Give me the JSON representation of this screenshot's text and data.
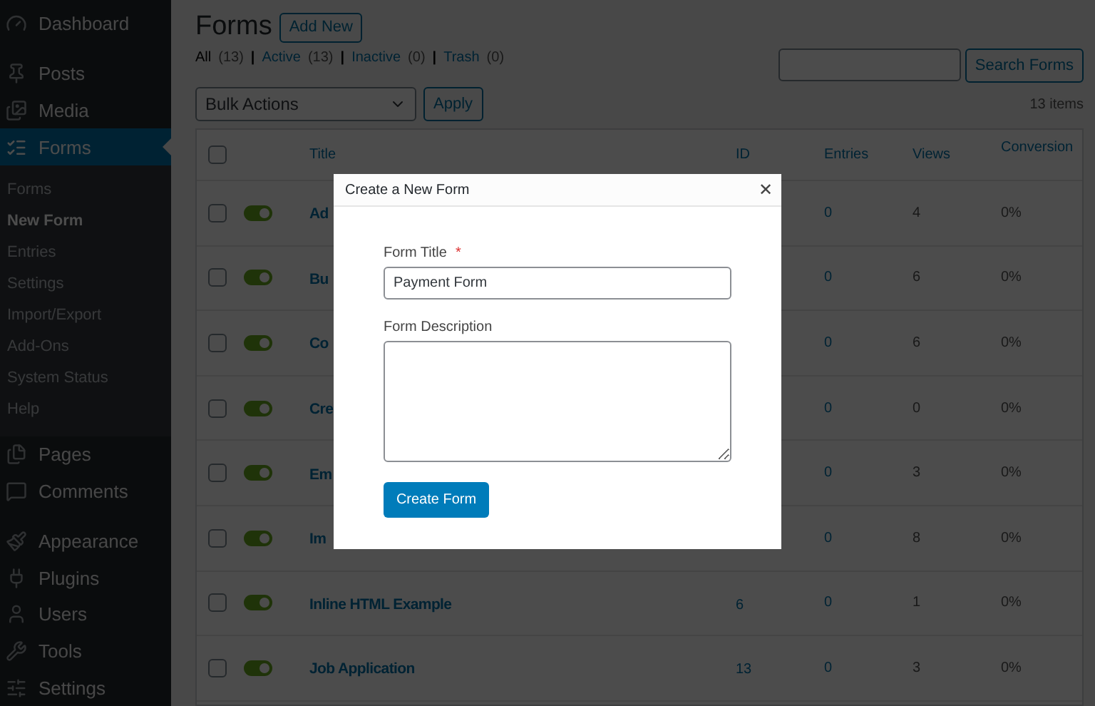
{
  "sidebar": {
    "items": [
      {
        "label": "Dashboard",
        "selected": false
      },
      {
        "label": "Posts",
        "selected": false
      },
      {
        "label": "Media",
        "selected": false
      },
      {
        "label": "Forms",
        "selected": true,
        "children": [
          {
            "label": "Forms",
            "selected": false
          },
          {
            "label": "New Form",
            "selected": true
          },
          {
            "label": "Entries",
            "selected": false
          },
          {
            "label": "Settings",
            "selected": false
          },
          {
            "label": "Import/Export",
            "selected": false
          },
          {
            "label": "Add-Ons",
            "selected": false
          },
          {
            "label": "System Status",
            "selected": false
          },
          {
            "label": "Help",
            "selected": false
          }
        ]
      },
      {
        "label": "Pages",
        "selected": false
      },
      {
        "label": "Comments",
        "selected": false
      },
      {
        "label": "Appearance",
        "selected": false
      },
      {
        "label": "Plugins",
        "selected": false
      },
      {
        "label": "Users",
        "selected": false
      },
      {
        "label": "Tools",
        "selected": false
      },
      {
        "label": "Settings",
        "selected": false
      }
    ]
  },
  "page": {
    "title": "Forms",
    "add_new": "Add New",
    "filter_separator": "|",
    "filters": [
      {
        "label": "All",
        "count": "(13)",
        "selected": true
      },
      {
        "label": "Active",
        "count": "(13)",
        "selected": false
      },
      {
        "label": "Inactive",
        "count": "(0)",
        "selected": false
      },
      {
        "label": "Trash",
        "count": "(0)",
        "selected": false
      }
    ],
    "search_button": "Search Forms",
    "bulk_actions": "Bulk Actions",
    "apply": "Apply",
    "item_count": "13 items"
  },
  "table": {
    "select_all_checked": false,
    "columns": [
      "Title",
      "ID",
      "Entries",
      "Views",
      "Conversion"
    ],
    "rows": [
      {
        "checked": false,
        "on": true,
        "title": "Ad",
        "entries": "0",
        "views": "4",
        "conversion": "0%"
      },
      {
        "checked": false,
        "on": true,
        "title": "Bu",
        "entries": "0",
        "views": "6",
        "conversion": "0%"
      },
      {
        "checked": false,
        "on": true,
        "title": "Co",
        "entries": "0",
        "views": "6",
        "conversion": "0%"
      },
      {
        "checked": false,
        "on": true,
        "title": "Cre",
        "entries": "0",
        "views": "0",
        "conversion": "0%"
      },
      {
        "checked": false,
        "on": true,
        "title": "Em",
        "entries": "0",
        "views": "3",
        "conversion": "0%"
      },
      {
        "checked": false,
        "on": true,
        "title": "Im",
        "entries": "0",
        "views": "8",
        "conversion": "0%"
      },
      {
        "checked": false,
        "on": true,
        "title": "Inline HTML Example",
        "id": "6",
        "entries": "0",
        "views": "1",
        "conversion": "0%"
      },
      {
        "checked": false,
        "on": true,
        "title": "Job Application",
        "id": "13",
        "entries": "0",
        "views": "3",
        "conversion": "0%"
      }
    ]
  },
  "dialog": {
    "title": "Create a New Form",
    "close": "✕",
    "title_label": "Form Title",
    "required_mark": "*",
    "title_value": "Payment Form",
    "description_label": "Form Description",
    "submit": "Create Form"
  }
}
